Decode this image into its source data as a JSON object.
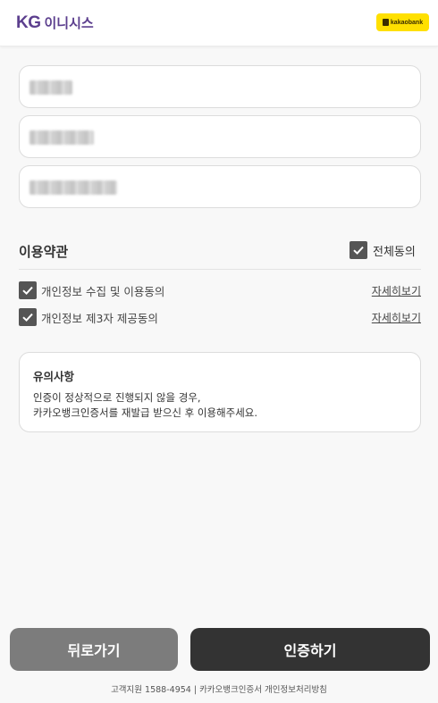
{
  "header": {
    "logo_kg": "KG",
    "logo_text": "이니시스",
    "partner_badge": "kakaobank"
  },
  "form": {
    "fields": [
      {
        "name": "name",
        "redacted": true
      },
      {
        "name": "phone",
        "redacted": true
      },
      {
        "name": "birth",
        "redacted": true
      }
    ]
  },
  "terms": {
    "title": "이용약관",
    "agree_all_label": "전체동의",
    "agree_all_checked": true,
    "items": [
      {
        "label": "개인정보 수집 및 이용동의",
        "detail_link": "자세히보기",
        "checked": true
      },
      {
        "label": "개인정보 제3자 제공동의",
        "detail_link": "자세히보기",
        "checked": true
      }
    ]
  },
  "notice": {
    "title": "유의사항",
    "lines": [
      "인증이 정상적으로 진행되지 않을 경우,",
      "카카오뱅크인증서를 재발급 받으신 후 이용해주세요."
    ]
  },
  "buttons": {
    "back_label": "뒤로가기",
    "auth_label": "인증하기"
  },
  "footer": {
    "text": "고객지원 1588-4954 | 카카오뱅크인증서 개인정보처리방침"
  },
  "colors": {
    "brand_purple": "#5c3f8e",
    "kakao_yellow": "#ffe000",
    "primary_button": "#333333",
    "secondary_button": "#7c7c7c"
  }
}
